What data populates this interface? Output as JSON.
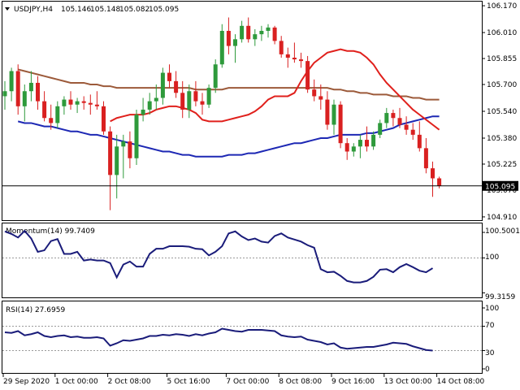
{
  "header": {
    "symbol": "USDJPY,H4",
    "open": "105.146",
    "high": "105.148",
    "low": "105.082",
    "close": "105.095"
  },
  "colors": {
    "bull": "#2e9a3b",
    "bear": "#d92020",
    "sma_fast": "#e0201c",
    "sma_mid": "#9c5a3a",
    "sma_slow": "#1d28b4",
    "osc": "#1a1c7a",
    "grid": "#9a9a9a"
  },
  "momentum_panel": {
    "label": "Momentum(14) 99.7409",
    "ticks": [
      "100.5001",
      "100",
      "99.3159"
    ]
  },
  "rsi_panel": {
    "label": "RSI(14) 27.6959",
    "ticks": [
      "100",
      "70",
      "30",
      "0"
    ]
  },
  "chart_data": [
    {
      "type": "candlestick",
      "title": "USDJPY,H4",
      "y_ticks": [
        106.17,
        106.01,
        105.855,
        105.7,
        105.54,
        105.38,
        105.225,
        105.07,
        104.91
      ],
      "ylim": [
        104.9,
        106.18
      ],
      "current_price": 105.095,
      "x_tick_labels": [
        "29 Sep 2020",
        "1 Oct 00:00",
        "2 Oct 08:00",
        "5 Oct 16:00",
        "7 Oct 00:00",
        "8 Oct 08:00",
        "9 Oct 16:00",
        "13 Oct 00:00",
        "14 Oct 08:00"
      ],
      "candles": [
        {
          "o": 105.63,
          "h": 105.72,
          "l": 105.55,
          "c": 105.66
        },
        {
          "o": 105.66,
          "h": 105.8,
          "l": 105.6,
          "c": 105.78
        },
        {
          "o": 105.78,
          "h": 105.82,
          "l": 105.52,
          "c": 105.57
        },
        {
          "o": 105.57,
          "h": 105.7,
          "l": 105.48,
          "c": 105.66
        },
        {
          "o": 105.66,
          "h": 105.78,
          "l": 105.6,
          "c": 105.71
        },
        {
          "o": 105.71,
          "h": 105.75,
          "l": 105.55,
          "c": 105.6
        },
        {
          "o": 105.6,
          "h": 105.66,
          "l": 105.48,
          "c": 105.5
        },
        {
          "o": 105.5,
          "h": 105.58,
          "l": 105.43,
          "c": 105.47
        },
        {
          "o": 105.47,
          "h": 105.6,
          "l": 105.44,
          "c": 105.57
        },
        {
          "o": 105.57,
          "h": 105.63,
          "l": 105.52,
          "c": 105.61
        },
        {
          "o": 105.61,
          "h": 105.66,
          "l": 105.55,
          "c": 105.58
        },
        {
          "o": 105.58,
          "h": 105.62,
          "l": 105.53,
          "c": 105.6
        },
        {
          "o": 105.6,
          "h": 105.63,
          "l": 105.55,
          "c": 105.59
        },
        {
          "o": 105.59,
          "h": 105.64,
          "l": 105.52,
          "c": 105.58
        },
        {
          "o": 105.58,
          "h": 105.66,
          "l": 105.55,
          "c": 105.57
        },
        {
          "o": 105.57,
          "h": 105.6,
          "l": 105.4,
          "c": 105.42
        },
        {
          "o": 105.42,
          "h": 105.45,
          "l": 104.95,
          "c": 105.16
        },
        {
          "o": 105.16,
          "h": 105.4,
          "l": 105.02,
          "c": 105.33
        },
        {
          "o": 105.33,
          "h": 105.4,
          "l": 105.14,
          "c": 105.36
        },
        {
          "o": 105.36,
          "h": 105.42,
          "l": 105.2,
          "c": 105.26
        },
        {
          "o": 105.26,
          "h": 105.55,
          "l": 105.22,
          "c": 105.52
        },
        {
          "o": 105.52,
          "h": 105.62,
          "l": 105.48,
          "c": 105.55
        },
        {
          "o": 105.55,
          "h": 105.65,
          "l": 105.52,
          "c": 105.6
        },
        {
          "o": 105.6,
          "h": 105.7,
          "l": 105.55,
          "c": 105.62
        },
        {
          "o": 105.62,
          "h": 105.8,
          "l": 105.58,
          "c": 105.77
        },
        {
          "o": 105.77,
          "h": 105.82,
          "l": 105.68,
          "c": 105.72
        },
        {
          "o": 105.72,
          "h": 105.78,
          "l": 105.62,
          "c": 105.65
        },
        {
          "o": 105.65,
          "h": 105.72,
          "l": 105.5,
          "c": 105.55
        },
        {
          "o": 105.55,
          "h": 105.7,
          "l": 105.5,
          "c": 105.66
        },
        {
          "o": 105.66,
          "h": 105.72,
          "l": 105.57,
          "c": 105.6
        },
        {
          "o": 105.6,
          "h": 105.65,
          "l": 105.52,
          "c": 105.58
        },
        {
          "o": 105.58,
          "h": 105.7,
          "l": 105.56,
          "c": 105.68
        },
        {
          "o": 105.68,
          "h": 105.85,
          "l": 105.65,
          "c": 105.82
        },
        {
          "o": 105.82,
          "h": 106.06,
          "l": 105.8,
          "c": 106.02
        },
        {
          "o": 106.02,
          "h": 106.1,
          "l": 105.88,
          "c": 105.93
        },
        {
          "o": 105.93,
          "h": 106.0,
          "l": 105.83,
          "c": 105.97
        },
        {
          "o": 105.97,
          "h": 106.08,
          "l": 105.95,
          "c": 106.05
        },
        {
          "o": 106.05,
          "h": 106.1,
          "l": 105.95,
          "c": 105.97
        },
        {
          "o": 105.97,
          "h": 106.03,
          "l": 105.93,
          "c": 106.0
        },
        {
          "o": 106.0,
          "h": 106.05,
          "l": 105.96,
          "c": 106.02
        },
        {
          "o": 106.02,
          "h": 106.06,
          "l": 105.98,
          "c": 106.04
        },
        {
          "o": 106.04,
          "h": 106.05,
          "l": 105.94,
          "c": 105.96
        },
        {
          "o": 105.96,
          "h": 105.99,
          "l": 105.86,
          "c": 105.88
        },
        {
          "o": 105.88,
          "h": 105.92,
          "l": 105.8,
          "c": 105.86
        },
        {
          "o": 105.86,
          "h": 105.95,
          "l": 105.83,
          "c": 105.85
        },
        {
          "o": 105.85,
          "h": 105.89,
          "l": 105.8,
          "c": 105.84
        },
        {
          "o": 105.84,
          "h": 105.87,
          "l": 105.65,
          "c": 105.67
        },
        {
          "o": 105.67,
          "h": 105.73,
          "l": 105.6,
          "c": 105.63
        },
        {
          "o": 105.63,
          "h": 105.7,
          "l": 105.55,
          "c": 105.61
        },
        {
          "o": 105.61,
          "h": 105.66,
          "l": 105.43,
          "c": 105.46
        },
        {
          "o": 105.46,
          "h": 105.61,
          "l": 105.4,
          "c": 105.58
        },
        {
          "o": 105.58,
          "h": 105.6,
          "l": 105.32,
          "c": 105.35
        },
        {
          "o": 105.35,
          "h": 105.38,
          "l": 105.25,
          "c": 105.3
        },
        {
          "o": 105.3,
          "h": 105.35,
          "l": 105.27,
          "c": 105.33
        },
        {
          "o": 105.33,
          "h": 105.4,
          "l": 105.26,
          "c": 105.37
        },
        {
          "o": 105.37,
          "h": 105.45,
          "l": 105.3,
          "c": 105.33
        },
        {
          "o": 105.33,
          "h": 105.42,
          "l": 105.31,
          "c": 105.4
        },
        {
          "o": 105.4,
          "h": 105.49,
          "l": 105.38,
          "c": 105.47
        },
        {
          "o": 105.47,
          "h": 105.56,
          "l": 105.44,
          "c": 105.53
        },
        {
          "o": 105.53,
          "h": 105.55,
          "l": 105.45,
          "c": 105.5
        },
        {
          "o": 105.5,
          "h": 105.56,
          "l": 105.44,
          "c": 105.46
        },
        {
          "o": 105.46,
          "h": 105.51,
          "l": 105.4,
          "c": 105.43
        },
        {
          "o": 105.43,
          "h": 105.47,
          "l": 105.37,
          "c": 105.4
        },
        {
          "o": 105.4,
          "h": 105.48,
          "l": 105.3,
          "c": 105.32
        },
        {
          "o": 105.32,
          "h": 105.38,
          "l": 105.17,
          "c": 105.2
        },
        {
          "o": 105.2,
          "h": 105.24,
          "l": 105.03,
          "c": 105.14
        },
        {
          "o": 105.14,
          "h": 105.15,
          "l": 105.08,
          "c": 105.095
        }
      ],
      "series": [
        {
          "name": "sma_slow",
          "values": [
            105.48,
            105.47,
            105.47,
            105.46,
            105.45,
            105.45,
            105.44,
            105.43,
            105.42,
            105.42,
            105.41,
            105.4,
            105.4,
            105.39,
            105.38,
            105.37,
            105.36,
            105.35,
            105.34,
            105.33,
            105.32,
            105.31,
            105.3,
            105.3,
            105.29,
            105.28,
            105.28,
            105.27,
            105.27,
            105.27,
            105.27,
            105.27,
            105.28,
            105.28,
            105.28,
            105.29,
            105.29,
            105.3,
            105.31,
            105.32,
            105.33,
            105.34,
            105.35,
            105.35,
            105.36,
            105.37,
            105.38,
            105.38,
            105.39,
            105.4,
            105.4,
            105.4,
            105.4,
            105.41,
            105.41,
            105.42,
            105.43,
            105.44,
            105.46,
            105.47,
            105.48,
            105.49,
            105.5,
            105.51,
            105.51
          ]
        },
        {
          "name": "sma_mid",
          "values": [
            105.79,
            105.78,
            105.77,
            105.76,
            105.75,
            105.74,
            105.73,
            105.72,
            105.71,
            105.71,
            105.71,
            105.7,
            105.7,
            105.69,
            105.69,
            105.68,
            105.68,
            105.68,
            105.68,
            105.68,
            105.68,
            105.68,
            105.68,
            105.68,
            105.68,
            105.68,
            105.68,
            105.67,
            105.67,
            105.67,
            105.67,
            105.67,
            105.68,
            105.68,
            105.68,
            105.68,
            105.68,
            105.68,
            105.68,
            105.68,
            105.68,
            105.68,
            105.68,
            105.68,
            105.68,
            105.68,
            105.68,
            105.68,
            105.67,
            105.67,
            105.66,
            105.66,
            105.65,
            105.65,
            105.64,
            105.64,
            105.64,
            105.63,
            105.63,
            105.63,
            105.62,
            105.62,
            105.61,
            105.61,
            105.61
          ]
        },
        {
          "name": "sma_fast",
          "values": [
            105.48,
            105.5,
            105.51,
            105.52,
            105.52,
            105.52,
            105.53,
            105.55,
            105.56,
            105.57,
            105.57,
            105.56,
            105.55,
            105.53,
            105.49,
            105.48,
            105.48,
            105.48,
            105.49,
            105.5,
            105.51,
            105.52,
            105.54,
            105.57,
            105.61,
            105.63,
            105.63,
            105.63,
            105.65,
            105.72,
            105.78,
            105.83,
            105.86,
            105.89,
            105.9,
            105.91,
            105.9,
            105.9,
            105.89,
            105.86,
            105.82,
            105.76,
            105.71,
            105.67,
            105.63,
            105.59,
            105.55,
            105.52,
            105.49,
            105.46,
            105.43
          ]
        }
      ]
    },
    {
      "type": "line",
      "title": "Momentum(14)",
      "ylim": [
        99.26,
        100.58
      ],
      "values": [
        100.52,
        100.47,
        100.4,
        100.53,
        100.38,
        100.12,
        100.15,
        100.33,
        100.37,
        100.08,
        100.08,
        100.12,
        99.95,
        99.97,
        99.95,
        99.95,
        99.9,
        99.62,
        99.87,
        99.93,
        99.83,
        99.83,
        100.08,
        100.18,
        100.18,
        100.23,
        100.23,
        100.23,
        100.22,
        100.18,
        100.17,
        100.05,
        100.12,
        100.23,
        100.48,
        100.52,
        100.42,
        100.35,
        100.38,
        100.32,
        100.3,
        100.43,
        100.48,
        100.4,
        100.36,
        100.32,
        100.25,
        100.2,
        99.78,
        99.72,
        99.73,
        99.65,
        99.55,
        99.52,
        99.52,
        99.55,
        99.63,
        99.77,
        99.78,
        99.72,
        99.82,
        99.88,
        99.82,
        99.75,
        99.72,
        99.8
      ]
    },
    {
      "type": "line",
      "title": "RSI(14)",
      "ylim": [
        0,
        100
      ],
      "levels": [
        70,
        30
      ],
      "values": [
        60,
        59,
        62,
        55,
        57,
        60,
        54,
        52,
        54,
        55,
        52,
        53,
        51,
        51,
        52,
        50,
        38,
        42,
        47,
        46,
        48,
        50,
        54,
        54,
        56,
        55,
        57,
        56,
        54,
        57,
        55,
        58,
        60,
        66,
        64,
        62,
        61,
        64,
        64,
        64,
        63,
        62,
        55,
        53,
        52,
        53,
        48,
        46,
        44,
        40,
        42,
        35,
        33,
        34,
        35,
        36,
        36,
        38,
        40,
        43,
        42,
        41,
        37,
        34,
        31,
        30
      ]
    }
  ]
}
